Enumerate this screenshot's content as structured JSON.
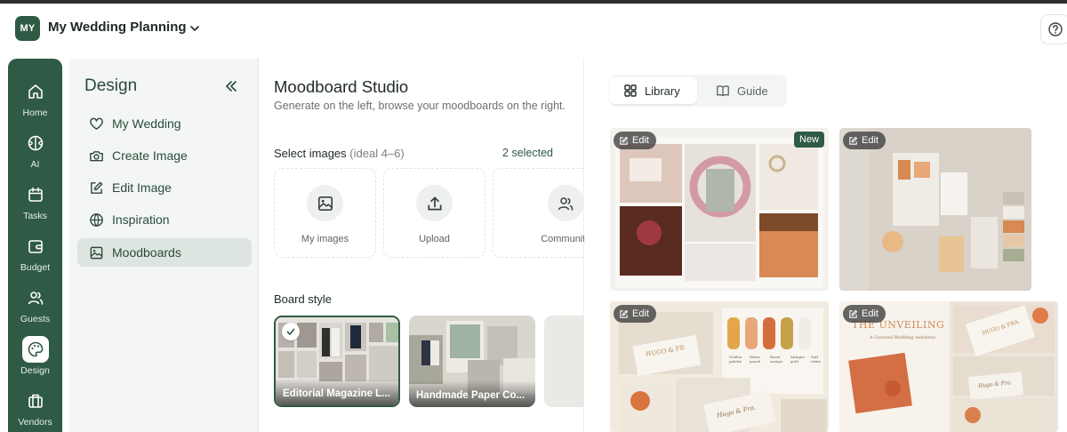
{
  "project": {
    "avatar_initials": "MY",
    "title": "My Wedding Planning"
  },
  "rail": [
    {
      "label": "Home",
      "icon": "home-icon"
    },
    {
      "label": "AI",
      "icon": "ai-brain-icon"
    },
    {
      "label": "Tasks",
      "icon": "calendar-icon"
    },
    {
      "label": "Budget",
      "icon": "wallet-icon"
    },
    {
      "label": "Guests",
      "icon": "users-icon"
    },
    {
      "label": "Design",
      "icon": "palette-icon"
    },
    {
      "label": "Vendors",
      "icon": "store-icon"
    }
  ],
  "sidebar": {
    "title": "Design",
    "items": [
      {
        "label": "My Wedding",
        "icon": "heart-icon"
      },
      {
        "label": "Create Image",
        "icon": "camera-icon"
      },
      {
        "label": "Edit Image",
        "icon": "edit-icon"
      },
      {
        "label": "Inspiration",
        "icon": "globe-icon"
      },
      {
        "label": "Moodboards",
        "icon": "image-icon"
      }
    ]
  },
  "studio": {
    "title": "Moodboard Studio",
    "subtitle": "Generate on the left, browse your moodboards on the right.",
    "select_label": "Select images",
    "select_hint": "(ideal 4–6)",
    "selected_count": "2 selected",
    "sources": [
      {
        "label": "My images"
      },
      {
        "label": "Upload"
      },
      {
        "label": "Community"
      }
    ],
    "board_style_label": "Board style",
    "styles": [
      {
        "label": "Editorial Magazine L...",
        "selected": true
      },
      {
        "label": "Handmade Paper Co...",
        "selected": false
      }
    ]
  },
  "library": {
    "tabs": [
      {
        "label": "Library",
        "active": true
      },
      {
        "label": "Guide",
        "active": false
      }
    ],
    "edit_label": "Edit",
    "new_label": "New",
    "card3_words": {
      "swatch_labels": [
        "Golden palette",
        "Warm peach",
        "Burnt orange",
        "Antique gold",
        "Soft white"
      ],
      "card_text_a": "HUGO & FR",
      "card_text_b": "Hugo & Fra."
    },
    "card4_words": {
      "headline": "THE UNVEILING",
      "tagline": "A Curated Wedding Aesthetic",
      "card_text_a": "HUGO & FRA.",
      "card_text_b": "Hugo & Fra."
    }
  },
  "colors": {
    "brand": "#2f5a45",
    "accent_orange": "#d88a52"
  }
}
